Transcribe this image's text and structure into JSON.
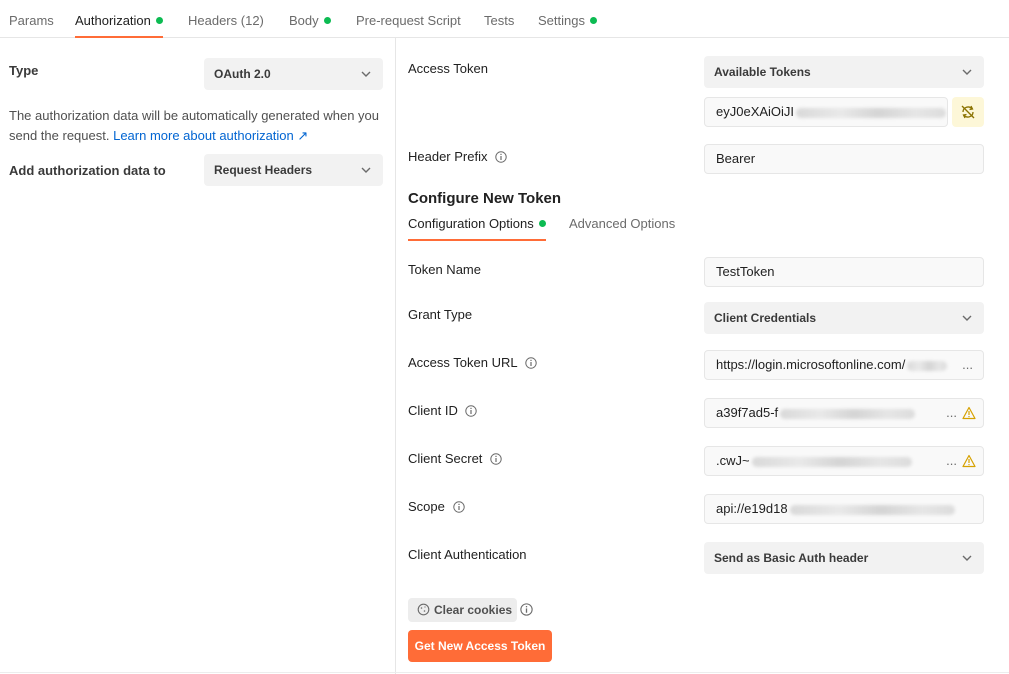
{
  "tabs": [
    {
      "label": "Params",
      "active": false,
      "dot": false
    },
    {
      "label": "Authorization",
      "active": true,
      "dot": true
    },
    {
      "label": "Headers",
      "count": "(12)",
      "active": false,
      "dot": false
    },
    {
      "label": "Body",
      "active": false,
      "dot": true
    },
    {
      "label": "Pre-request Script",
      "active": false,
      "dot": false
    },
    {
      "label": "Tests",
      "active": false,
      "dot": false
    },
    {
      "label": "Settings",
      "active": false,
      "dot": true
    }
  ],
  "left": {
    "type_label": "Type",
    "type_value": "OAuth 2.0",
    "description": "The authorization data will be automatically generated when you send the request.",
    "learn_more": "Learn more about authorization ↗",
    "add_to_label": "Add authorization data to",
    "add_to_value": "Request Headers"
  },
  "right": {
    "access_token_label": "Access Token",
    "available_tokens": "Available Tokens",
    "token_value": "eyJ0eXAiOiJI",
    "header_prefix_label": "Header Prefix",
    "header_prefix_value": "Bearer",
    "configure_title": "Configure New Token",
    "subtabs": {
      "config": "Configuration Options",
      "advanced": "Advanced Options"
    },
    "token_name_label": "Token Name",
    "token_name_value": "TestToken",
    "grant_type_label": "Grant Type",
    "grant_type_value": "Client Credentials",
    "access_token_url_label": "Access Token URL",
    "access_token_url_value": "https://login.microsoftonline.com/",
    "client_id_label": "Client ID",
    "client_id_value": "a39f7ad5-f",
    "client_secret_label": "Client Secret",
    "client_secret_value": ".cwJ~",
    "scope_label": "Scope",
    "scope_value": "api://e19d18",
    "client_auth_label": "Client Authentication",
    "client_auth_value": "Send as Basic Auth header",
    "ellipsis": "...",
    "clear_cookies": "Clear cookies",
    "get_token": "Get New Access Token"
  },
  "colors": {
    "accent": "#ff6c37",
    "status_dot": "#0cbb52",
    "link": "#0265d2",
    "warning": "#d6a100"
  },
  "icons": {
    "chevron": "chevron-down-icon",
    "info": "info-icon",
    "warning": "warning-icon",
    "sync": "sync-off-icon",
    "cookie": "cookie-icon"
  }
}
